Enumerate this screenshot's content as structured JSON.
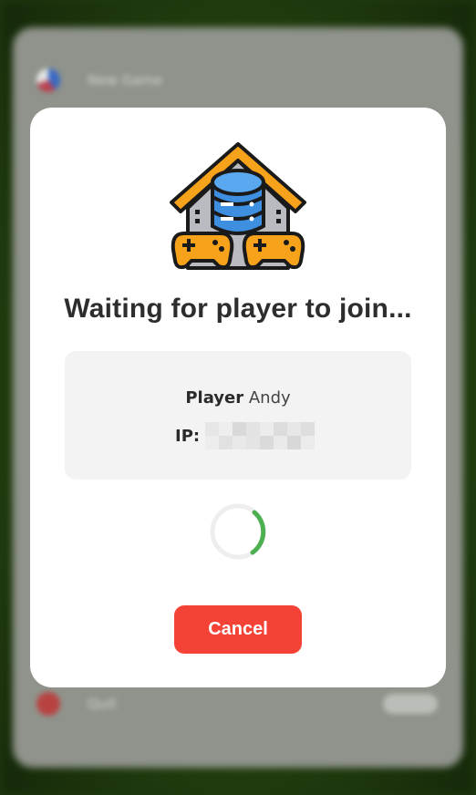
{
  "background": {
    "top_row_label": "New Game",
    "bottom_row_label": "Quit"
  },
  "modal": {
    "icon": "house-server-gamepads-icon",
    "title": "Waiting for player to join...",
    "player_label": "Player",
    "player_name": "Andy",
    "ip_label": "IP:",
    "ip_value_state": "pixelated",
    "spinner_icon": "loading-spinner-icon",
    "cancel_label": "Cancel"
  },
  "colors": {
    "accent_orange": "#f7a21b",
    "server_blue": "#3f8fe0",
    "spinner_green": "#4caf50",
    "cancel_red": "#f44336"
  }
}
